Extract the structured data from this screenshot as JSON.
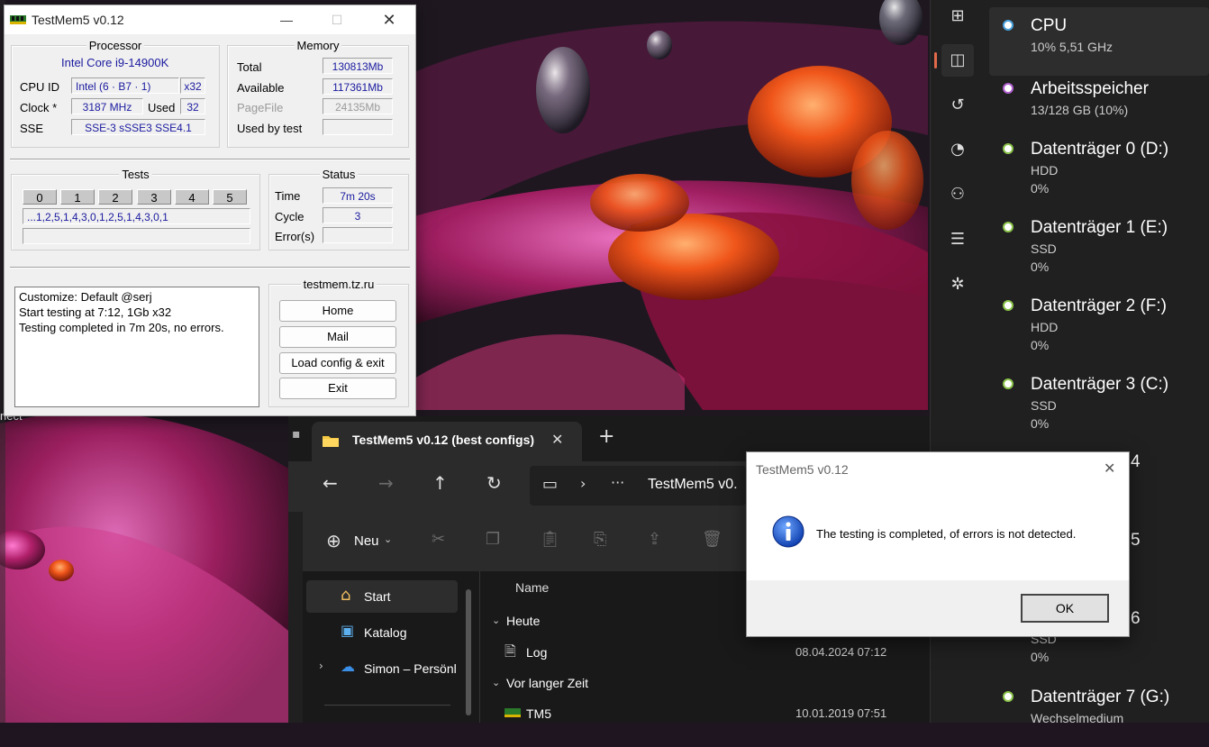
{
  "testmem": {
    "title": "TestMem5 v0.12",
    "processor": {
      "label": "Processor",
      "name": "Intel Core i9-14900K",
      "cpuid_label": "CPU ID",
      "cpuid_value": "Intel  (6 · B7 · 1)",
      "threads": "x32",
      "clock_label": "Clock *",
      "clock_value": "3187 MHz",
      "used_label": "Used",
      "used_value": "32",
      "sse_label": "SSE",
      "sse_value": "SSE-3 sSSE3 SSE4.1"
    },
    "memory": {
      "label": "Memory",
      "total_label": "Total",
      "total_value": "130813Mb",
      "available_label": "Available",
      "available_value": "117361Mb",
      "pagefile_label": "PageFile",
      "pagefile_value": "24135Mb",
      "usedbytest_label": "Used by test",
      "usedbytest_value": ""
    },
    "tests": {
      "label": "Tests",
      "numbers": [
        "0",
        "1",
        "2",
        "3",
        "4",
        "5"
      ],
      "sequence": "...1,2,5,1,4,3,0,1,2,5,1,4,3,0,1"
    },
    "status": {
      "label": "Status",
      "time_label": "Time",
      "time_value": "7m 20s",
      "cycle_label": "Cycle",
      "cycle_value": "3",
      "errors_label": "Error(s)",
      "errors_value": ""
    },
    "log": [
      "Customize: Default @serj",
      "Start testing at 7:12, 1Gb x32",
      "Testing completed in 7m 20s, no errors."
    ],
    "site": "testmem.tz.ru",
    "buttons": {
      "home": "Home",
      "mail": "Mail",
      "load": "Load config & exit",
      "exit": "Exit"
    }
  },
  "explorer": {
    "tab_title": "TestMem5 v0.12 (best configs)",
    "path_segment": "TestMem5 v0.",
    "new_label": "Neu",
    "nav": [
      "Start",
      "Katalog",
      "Simon – Persönl"
    ],
    "column_name": "Name",
    "groups": [
      {
        "label": "Heute",
        "files": [
          {
            "name": "Log",
            "date": "08.04.2024 07:12"
          }
        ]
      },
      {
        "label": "Vor langer Zeit",
        "files": [
          {
            "name": "TM5",
            "date": "10.01.2019 07:51"
          }
        ]
      }
    ]
  },
  "taskmgr": {
    "items": [
      {
        "name": "CPU",
        "sub1": "10%  5,51 GHz",
        "sub2": "",
        "color": "#4aa3df"
      },
      {
        "name": "Arbeitsspeicher",
        "sub1": "13/128 GB (10%)",
        "sub2": "",
        "color": "#b05fd0"
      },
      {
        "name": "Datenträger 0 (D:)",
        "sub1": "HDD",
        "sub2": "0%",
        "color": "#8bc34a"
      },
      {
        "name": "Datenträger 1 (E:)",
        "sub1": "SSD",
        "sub2": "0%",
        "color": "#8bc34a"
      },
      {
        "name": "Datenträger 2 (F:)",
        "sub1": "HDD",
        "sub2": "0%",
        "color": "#8bc34a"
      },
      {
        "name": "Datenträger 3 (C:)",
        "sub1": "SSD",
        "sub2": "0%",
        "color": "#8bc34a"
      }
    ],
    "partial": [
      {
        "suffix": "4"
      },
      {
        "suffix": "5"
      },
      {
        "suffix": "6",
        "sub1": "SSD",
        "sub2": "0%"
      }
    ],
    "last": {
      "name": "Datenträger 7 (G:)",
      "sub1": "Wechselmedium",
      "color": "#8bc34a"
    }
  },
  "dialog": {
    "title": "TestMem5 v0.12",
    "message": "The testing is completed, of errors is not detected.",
    "ok": "OK"
  },
  "desktop": {
    "fragment": "nect"
  }
}
